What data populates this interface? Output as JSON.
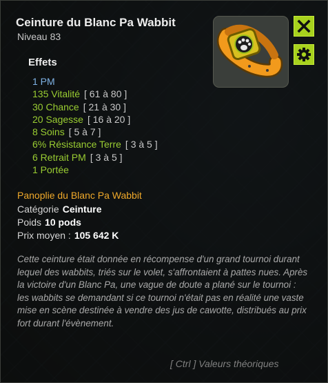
{
  "item": {
    "name": "Ceinture du Blanc Pa Wabbit",
    "level_label": "Niveau",
    "level_value": "83"
  },
  "buttons": {
    "close_icon": "close-x-icon",
    "settings_icon": "gear-icon"
  },
  "effects": {
    "heading": "Effets",
    "list": [
      {
        "value": "1 PM",
        "range": ""
      },
      {
        "value": "135 Vitalité",
        "range": "[ 61 à 80 ]"
      },
      {
        "value": "30 Chance",
        "range": "[ 21 à 30 ]"
      },
      {
        "value": "20 Sagesse",
        "range": "[ 16 à 20 ]"
      },
      {
        "value": "8 Soins",
        "range": "[ 5 à 7 ]"
      },
      {
        "value": "6% Résistance Terre",
        "range": "[ 3 à 5 ]"
      },
      {
        "value": "6 Retrait PM",
        "range": "[ 3 à 5 ]"
      },
      {
        "value": "1 Portée",
        "range": ""
      }
    ]
  },
  "set_name": "Panoplie du Blanc Pa Wabbit",
  "properties": [
    {
      "label": "Catégorie",
      "value": "Ceinture"
    },
    {
      "label": "Poids",
      "value": "10 pods"
    },
    {
      "label": "Prix moyen :",
      "value": "105 642 K"
    }
  ],
  "description": "Cette ceinture était donnée en récompense d'un grand tournoi durant lequel des wabbits, triés sur le volet, s'affrontaient à pattes nues. Après la victoire d'un Blanc Pa, une vague de doute a plané sur le tournoi : les wabbits se demandant si ce tournoi n'était pas en réalité une vaste mise en scène destinée à vendre des jus de cawotte, distribués au prix fort durant l'évènement.",
  "footer_hint": "[ Ctrl ] Valeurs théoriques",
  "colors": {
    "accent_green": "#a8d21e",
    "effect_green": "#9acd32",
    "first_effect_blue": "#7fb2e5",
    "set_orange": "#f0a92a",
    "item_orange": "#f29a1c",
    "item_green": "#b8dc20"
  }
}
